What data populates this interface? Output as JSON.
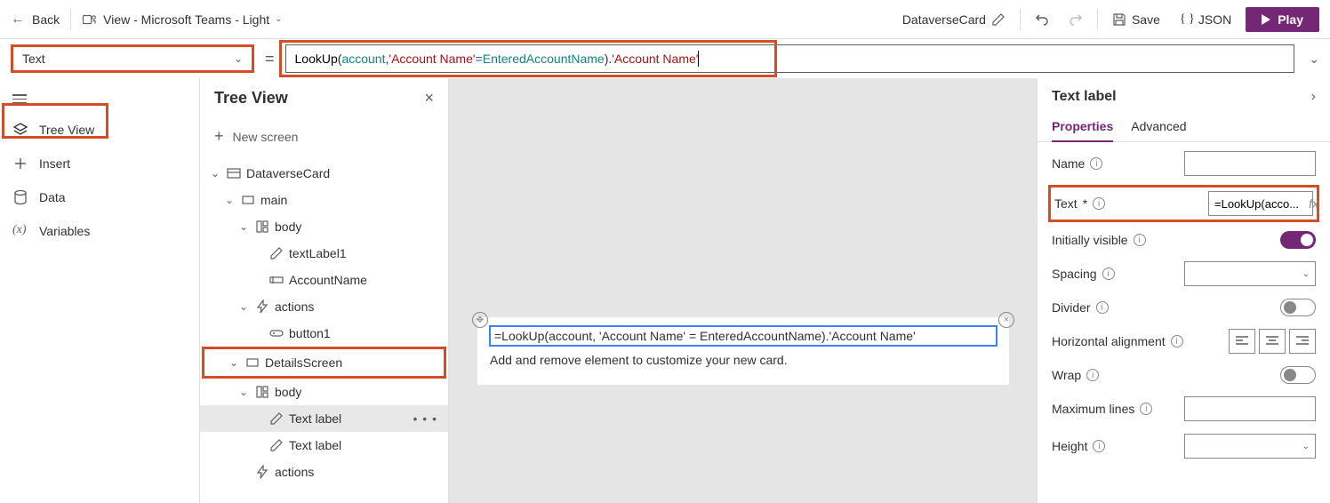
{
  "topbar": {
    "back": "Back",
    "view_label": "View - Microsoft Teams - Light",
    "card_name": "DataverseCard",
    "save": "Save",
    "json": "JSON",
    "play": "Play"
  },
  "formula": {
    "property": "Text",
    "tokens": {
      "func": "LookUp",
      "open": "(",
      "id1": "account",
      "comma": ", ",
      "str1": "'Account Name'",
      "op": " = ",
      "id2": "EnteredAccountName",
      "close": ").",
      "str2": "'Account Name'"
    }
  },
  "rail": {
    "tree_view": "Tree View",
    "insert": "Insert",
    "data": "Data",
    "variables": "Variables"
  },
  "tree": {
    "title": "Tree View",
    "new_screen": "New screen",
    "items": [
      {
        "label": "DataverseCard",
        "icon": "card",
        "indent": 0,
        "chevron": true
      },
      {
        "label": "main",
        "icon": "rect",
        "indent": 1,
        "chevron": true
      },
      {
        "label": "body",
        "icon": "body",
        "indent": 2,
        "chevron": true
      },
      {
        "label": "textLabel1",
        "icon": "edit",
        "indent": 3,
        "chevron": false
      },
      {
        "label": "AccountName",
        "icon": "input",
        "indent": 3,
        "chevron": false
      },
      {
        "label": "actions",
        "icon": "bolt",
        "indent": 2,
        "chevron": true
      },
      {
        "label": "button1",
        "icon": "button",
        "indent": 3,
        "chevron": false
      },
      {
        "label": "DetailsScreen",
        "icon": "rect",
        "indent": 1,
        "chevron": true,
        "highlight": true
      },
      {
        "label": "body",
        "icon": "body",
        "indent": 2,
        "chevron": true
      },
      {
        "label": "Text label",
        "icon": "edit",
        "indent": 3,
        "chevron": false,
        "selected": true
      },
      {
        "label": "Text label",
        "icon": "edit",
        "indent": 3,
        "chevron": false
      },
      {
        "label": "actions",
        "icon": "bolt",
        "indent": 2,
        "chevron": false
      }
    ]
  },
  "canvas": {
    "formula_text": "=LookUp(account, 'Account Name' = EnteredAccountName).'Account Name'",
    "helper_text": "Add and remove element to customize your new card."
  },
  "props": {
    "panel_title": "Text label",
    "tab_properties": "Properties",
    "tab_advanced": "Advanced",
    "name_label": "Name",
    "name_value": "",
    "text_label": "Text",
    "text_value": "=LookUp(acco...",
    "visible_label": "Initially visible",
    "spacing_label": "Spacing",
    "divider_label": "Divider",
    "halign_label": "Horizontal alignment",
    "wrap_label": "Wrap",
    "maxlines_label": "Maximum lines",
    "height_label": "Height",
    "fx": "fx"
  }
}
